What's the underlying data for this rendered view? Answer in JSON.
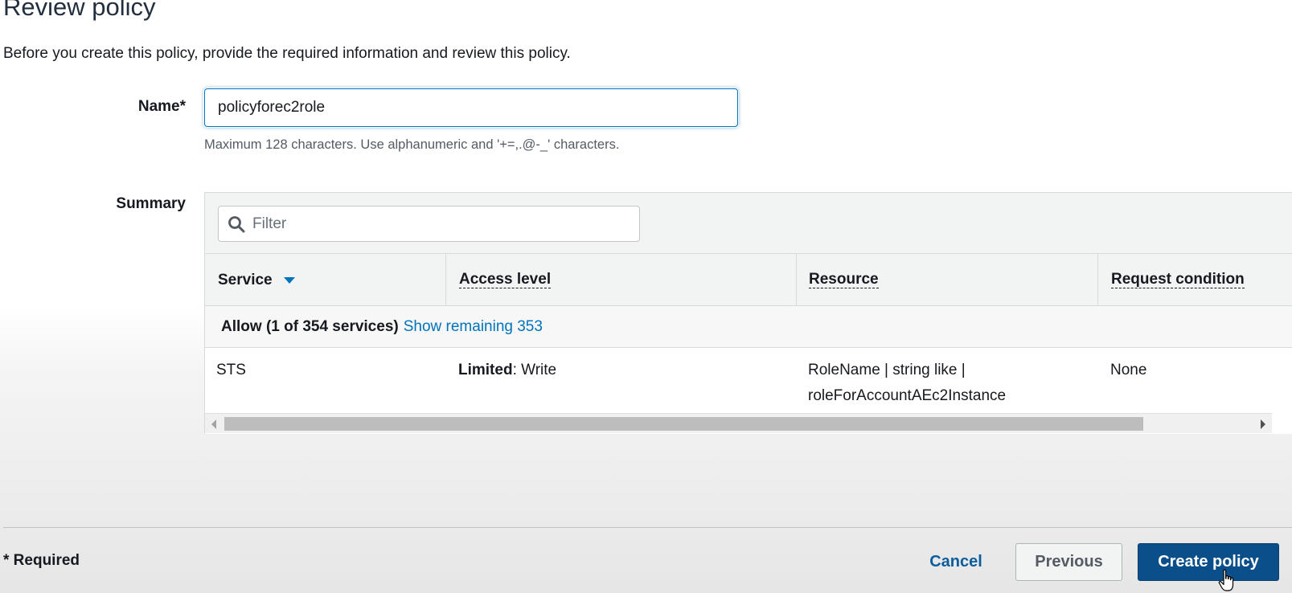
{
  "page": {
    "title": "Review policy",
    "description": "Before you create this policy, provide the required information and review this policy."
  },
  "name_field": {
    "label": "Name*",
    "value": "policyforec2role",
    "hint": "Maximum 128 characters. Use alphanumeric and '+=,.@-_' characters."
  },
  "summary": {
    "label": "Summary",
    "filter": {
      "placeholder": "Filter",
      "icon": "search-icon"
    },
    "columns": [
      "Service",
      "Access level",
      "Resource",
      "Request condition"
    ],
    "group": {
      "text": "Allow (1 of 354 services)",
      "link": "Show remaining 353"
    },
    "rows": [
      {
        "service": "STS",
        "access_level_bold": "Limited",
        "access_level_rest": ": Write",
        "resource_line1": "RoleName | string like |",
        "resource_line2": "roleForAccountAEc2Instance",
        "request_condition": "None"
      }
    ]
  },
  "footer": {
    "required_note": "* Required",
    "cancel_label": "Cancel",
    "previous_label": "Previous",
    "create_label": "Create policy"
  },
  "colors": {
    "link": "#0073bb",
    "primary_button": "#0b4f8a",
    "focus_border": "#0073bb"
  }
}
